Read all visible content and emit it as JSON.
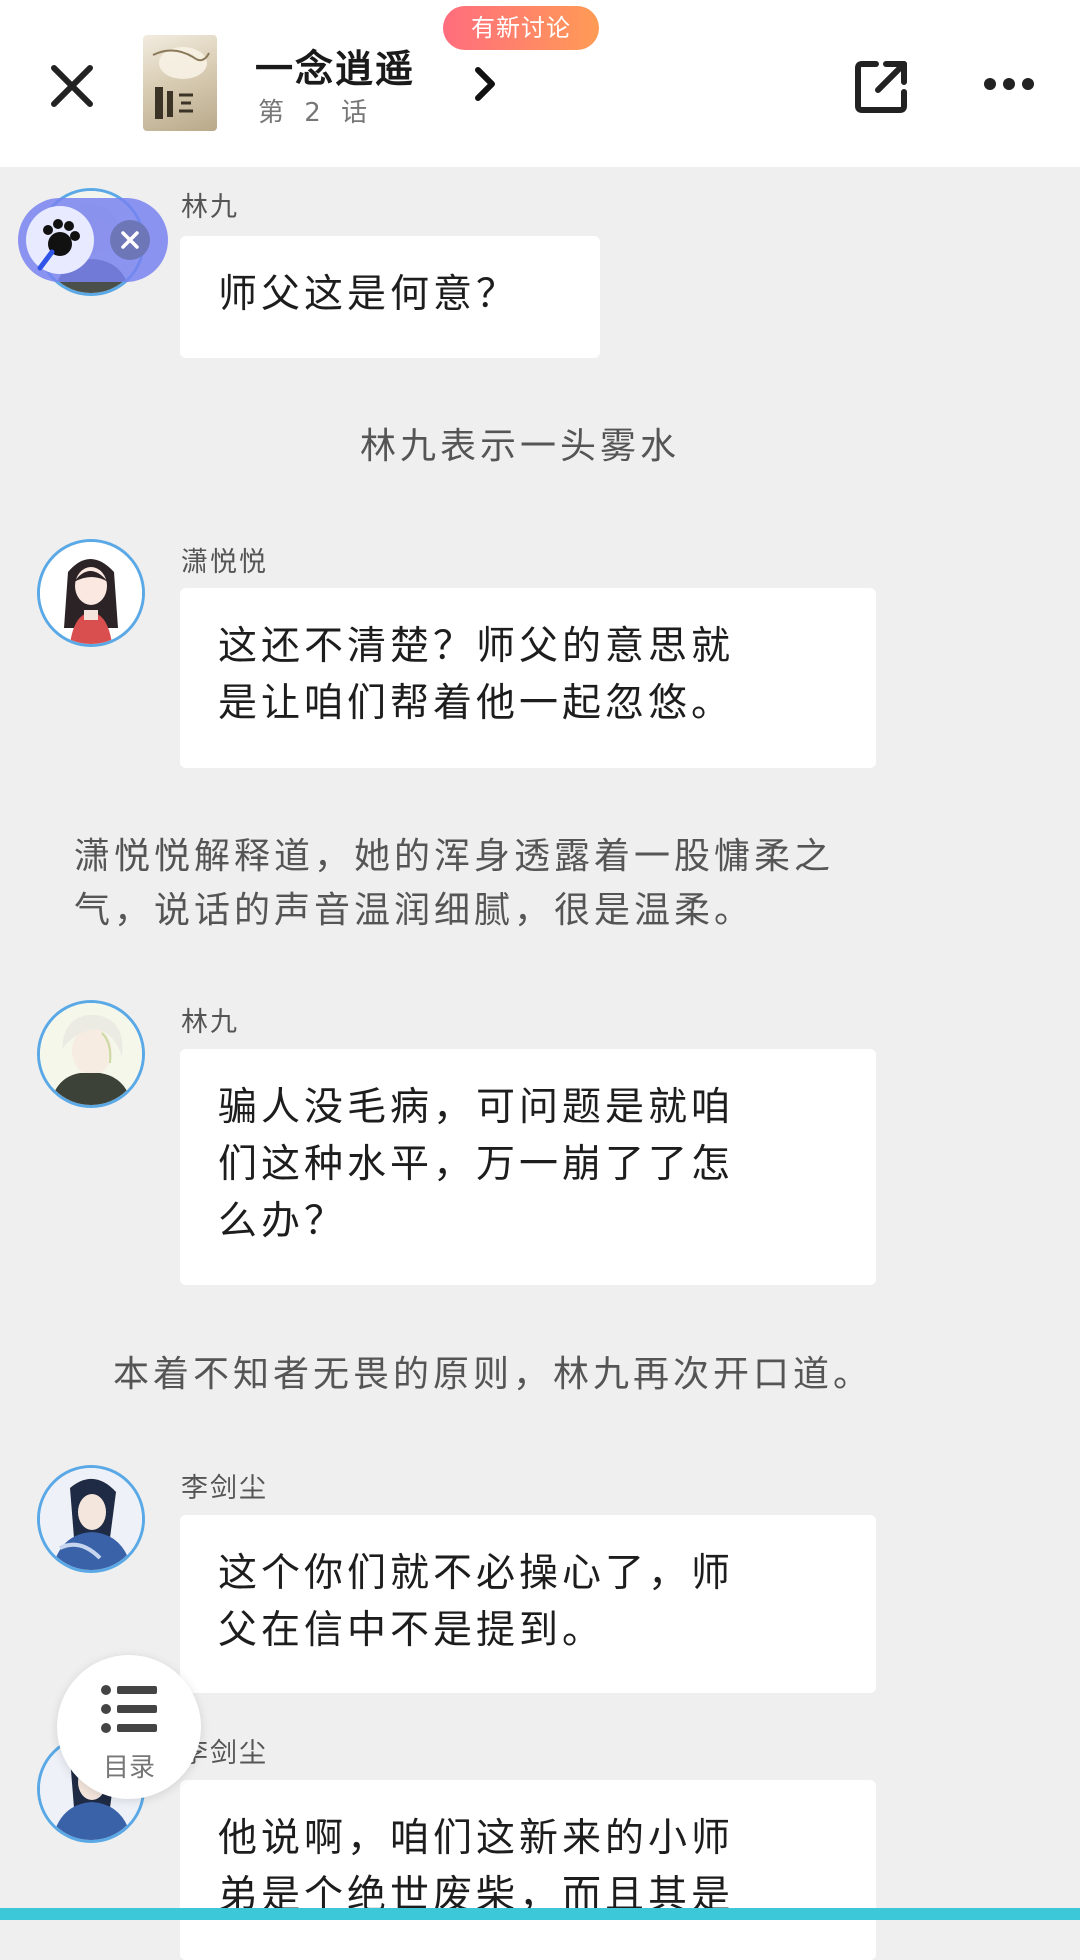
{
  "header": {
    "title": "一念逍遥",
    "chapter": "第 2 话",
    "badge": "有新讨论"
  },
  "messages": [
    {
      "kind": "chat",
      "name": "林九",
      "avatar": "lin-jiu",
      "lines": [
        "师父这是何意？"
      ]
    },
    {
      "kind": "narration",
      "lines": [
        "林九表示一头雾水"
      ]
    },
    {
      "kind": "chat",
      "name": "潇悦悦",
      "avatar": "xiao-yueyue",
      "lines": [
        "这还不清楚？师父的意思就",
        "是让咱们帮着他一起忽悠。"
      ]
    },
    {
      "kind": "narration",
      "lines": [
        "潇悦悦解释道，她的浑身透露着一股慵柔之",
        "气，说话的声音温润细腻，很是温柔。"
      ]
    },
    {
      "kind": "chat",
      "name": "林九",
      "avatar": "lin-jiu",
      "lines": [
        "骗人没毛病，可问题是就咱",
        "们这种水平，万一崩了了怎",
        "么办？"
      ]
    },
    {
      "kind": "narration",
      "lines": [
        "本着不知者无畏的原则，林九再次开口道。"
      ]
    },
    {
      "kind": "chat",
      "name": "李剑尘",
      "avatar": "li-jianchen",
      "lines": [
        "这个你们就不必操心了，师",
        "父在信中不是提到。"
      ]
    },
    {
      "kind": "chat",
      "name": "李剑尘",
      "avatar": "li-jianchen",
      "lines": [
        "他说啊，咱们这新来的小师",
        "弟是个绝世废柴，而且其是"
      ]
    }
  ],
  "toc": {
    "label": "目录"
  },
  "colors": {
    "accent_border": "#5aa9e6",
    "badge_start": "#ff6d7e",
    "badge_end": "#ff9b55",
    "background": "#efefef",
    "bottom_bar": "#3cc8d8"
  }
}
